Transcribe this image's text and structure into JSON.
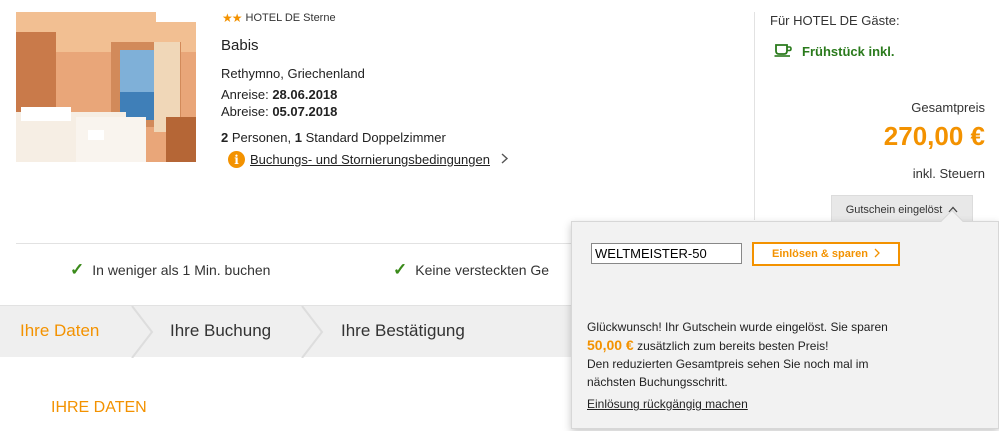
{
  "hotel": {
    "stars_label": "HOTEL DE Sterne",
    "name": "Babis",
    "location": "Rethymno, Griechenland",
    "checkin_label": "Anreise:",
    "checkin_date": "28.06.2018",
    "checkout_label": "Abreise:",
    "checkout_date": "05.07.2018",
    "persons_count": "2",
    "persons_label": "Personen,",
    "rooms_count": "1",
    "room_type": "Standard Doppelzimmer",
    "conditions_link": "Buchungs- und Stornierungsbedingungen"
  },
  "pricing": {
    "guests_label": "Für HOTEL DE Gäste:",
    "breakfast_label": "Frühstück inkl.",
    "total_label": "Gesamtpreis",
    "total_price": "270,00 €",
    "tax_note": "inkl. Steuern",
    "voucher_toggle": "Gutschein eingelöst"
  },
  "usps": [
    {
      "label": "In weniger als 1 Min. buchen"
    },
    {
      "label": "Keine versteckten Ge"
    }
  ],
  "steps": [
    {
      "label": "Ihre Daten",
      "active": true
    },
    {
      "label": "Ihre Buchung",
      "active": false
    },
    {
      "label": "Ihre Bestätigung",
      "active": false
    }
  ],
  "section": {
    "heading": "IHRE DATEN"
  },
  "voucher": {
    "code": "WELTMEISTER-50",
    "redeem_label": "Einlösen & sparen",
    "success_line1": "Glückwunsch! Ihr Gutschein wurde eingelöst. Sie sparen",
    "saved_amount": "50,00 €",
    "success_line2": "zusätzlich zum bereits besten Preis!",
    "success_line3": "Den reduzierten Gesamtpreis sehen Sie noch mal im",
    "success_line4": "nächsten Buchungsschritt.",
    "undo_link": "Einlösung rückgängig machen"
  },
  "colors": {
    "accent": "#f39200",
    "success": "#2a7a1c",
    "step_bar": "#efefef"
  },
  "icons": {
    "stars": "star-icon",
    "info": "info-icon",
    "breakfast": "coffee-cup-icon",
    "check": "check-icon",
    "chevron": "chevron-right-icon",
    "toggle": "chevron-up-icon"
  }
}
